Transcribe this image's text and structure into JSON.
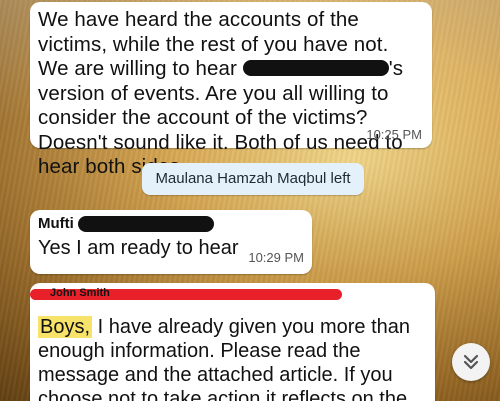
{
  "messages": [
    {
      "text_before": "We have heard the accounts of the victims, while the rest of you have not.  We are willing to hear ",
      "text_after": "'s version of events. Are you all willing to consider the account of the victims? Doesn't sound like it. Both of us need to hear both sides",
      "time": "10:25 PM"
    },
    {
      "sender_prefix": "Mufti",
      "text": "Yes I am ready to hear",
      "time": "10:29 PM"
    },
    {
      "overlay_name": "John Smith",
      "highlight": "Boys,",
      "text": " I have already given you more than enough information.  Please read the message and the attached article.  If you choose not to take action it reflects on the"
    }
  ],
  "system_notice": "Maulana Hamzah Maqbul left",
  "colors": {
    "system_bg": "#e5f1fa",
    "redline": "#e8202a",
    "highlight": "#f7e36a"
  },
  "icons": {
    "scroll_down": "chevron-double-down-icon"
  }
}
